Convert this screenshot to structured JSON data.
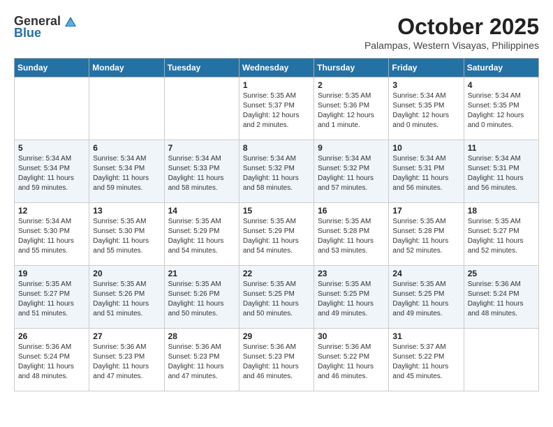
{
  "logo": {
    "general": "General",
    "blue": "Blue"
  },
  "title": "October 2025",
  "location": "Palampas, Western Visayas, Philippines",
  "days_of_week": [
    "Sunday",
    "Monday",
    "Tuesday",
    "Wednesday",
    "Thursday",
    "Friday",
    "Saturday"
  ],
  "weeks": [
    [
      {
        "day": "",
        "info": ""
      },
      {
        "day": "",
        "info": ""
      },
      {
        "day": "",
        "info": ""
      },
      {
        "day": "1",
        "info": "Sunrise: 5:35 AM\nSunset: 5:37 PM\nDaylight: 12 hours\nand 2 minutes."
      },
      {
        "day": "2",
        "info": "Sunrise: 5:35 AM\nSunset: 5:36 PM\nDaylight: 12 hours\nand 1 minute."
      },
      {
        "day": "3",
        "info": "Sunrise: 5:34 AM\nSunset: 5:35 PM\nDaylight: 12 hours\nand 0 minutes."
      },
      {
        "day": "4",
        "info": "Sunrise: 5:34 AM\nSunset: 5:35 PM\nDaylight: 12 hours\nand 0 minutes."
      }
    ],
    [
      {
        "day": "5",
        "info": "Sunrise: 5:34 AM\nSunset: 5:34 PM\nDaylight: 11 hours\nand 59 minutes."
      },
      {
        "day": "6",
        "info": "Sunrise: 5:34 AM\nSunset: 5:34 PM\nDaylight: 11 hours\nand 59 minutes."
      },
      {
        "day": "7",
        "info": "Sunrise: 5:34 AM\nSunset: 5:33 PM\nDaylight: 11 hours\nand 58 minutes."
      },
      {
        "day": "8",
        "info": "Sunrise: 5:34 AM\nSunset: 5:32 PM\nDaylight: 11 hours\nand 58 minutes."
      },
      {
        "day": "9",
        "info": "Sunrise: 5:34 AM\nSunset: 5:32 PM\nDaylight: 11 hours\nand 57 minutes."
      },
      {
        "day": "10",
        "info": "Sunrise: 5:34 AM\nSunset: 5:31 PM\nDaylight: 11 hours\nand 56 minutes."
      },
      {
        "day": "11",
        "info": "Sunrise: 5:34 AM\nSunset: 5:31 PM\nDaylight: 11 hours\nand 56 minutes."
      }
    ],
    [
      {
        "day": "12",
        "info": "Sunrise: 5:34 AM\nSunset: 5:30 PM\nDaylight: 11 hours\nand 55 minutes."
      },
      {
        "day": "13",
        "info": "Sunrise: 5:35 AM\nSunset: 5:30 PM\nDaylight: 11 hours\nand 55 minutes."
      },
      {
        "day": "14",
        "info": "Sunrise: 5:35 AM\nSunset: 5:29 PM\nDaylight: 11 hours\nand 54 minutes."
      },
      {
        "day": "15",
        "info": "Sunrise: 5:35 AM\nSunset: 5:29 PM\nDaylight: 11 hours\nand 54 minutes."
      },
      {
        "day": "16",
        "info": "Sunrise: 5:35 AM\nSunset: 5:28 PM\nDaylight: 11 hours\nand 53 minutes."
      },
      {
        "day": "17",
        "info": "Sunrise: 5:35 AM\nSunset: 5:28 PM\nDaylight: 11 hours\nand 52 minutes."
      },
      {
        "day": "18",
        "info": "Sunrise: 5:35 AM\nSunset: 5:27 PM\nDaylight: 11 hours\nand 52 minutes."
      }
    ],
    [
      {
        "day": "19",
        "info": "Sunrise: 5:35 AM\nSunset: 5:27 PM\nDaylight: 11 hours\nand 51 minutes."
      },
      {
        "day": "20",
        "info": "Sunrise: 5:35 AM\nSunset: 5:26 PM\nDaylight: 11 hours\nand 51 minutes."
      },
      {
        "day": "21",
        "info": "Sunrise: 5:35 AM\nSunset: 5:26 PM\nDaylight: 11 hours\nand 50 minutes."
      },
      {
        "day": "22",
        "info": "Sunrise: 5:35 AM\nSunset: 5:25 PM\nDaylight: 11 hours\nand 50 minutes."
      },
      {
        "day": "23",
        "info": "Sunrise: 5:35 AM\nSunset: 5:25 PM\nDaylight: 11 hours\nand 49 minutes."
      },
      {
        "day": "24",
        "info": "Sunrise: 5:35 AM\nSunset: 5:25 PM\nDaylight: 11 hours\nand 49 minutes."
      },
      {
        "day": "25",
        "info": "Sunrise: 5:36 AM\nSunset: 5:24 PM\nDaylight: 11 hours\nand 48 minutes."
      }
    ],
    [
      {
        "day": "26",
        "info": "Sunrise: 5:36 AM\nSunset: 5:24 PM\nDaylight: 11 hours\nand 48 minutes."
      },
      {
        "day": "27",
        "info": "Sunrise: 5:36 AM\nSunset: 5:23 PM\nDaylight: 11 hours\nand 47 minutes."
      },
      {
        "day": "28",
        "info": "Sunrise: 5:36 AM\nSunset: 5:23 PM\nDaylight: 11 hours\nand 47 minutes."
      },
      {
        "day": "29",
        "info": "Sunrise: 5:36 AM\nSunset: 5:23 PM\nDaylight: 11 hours\nand 46 minutes."
      },
      {
        "day": "30",
        "info": "Sunrise: 5:36 AM\nSunset: 5:22 PM\nDaylight: 11 hours\nand 46 minutes."
      },
      {
        "day": "31",
        "info": "Sunrise: 5:37 AM\nSunset: 5:22 PM\nDaylight: 11 hours\nand 45 minutes."
      },
      {
        "day": "",
        "info": ""
      }
    ]
  ]
}
